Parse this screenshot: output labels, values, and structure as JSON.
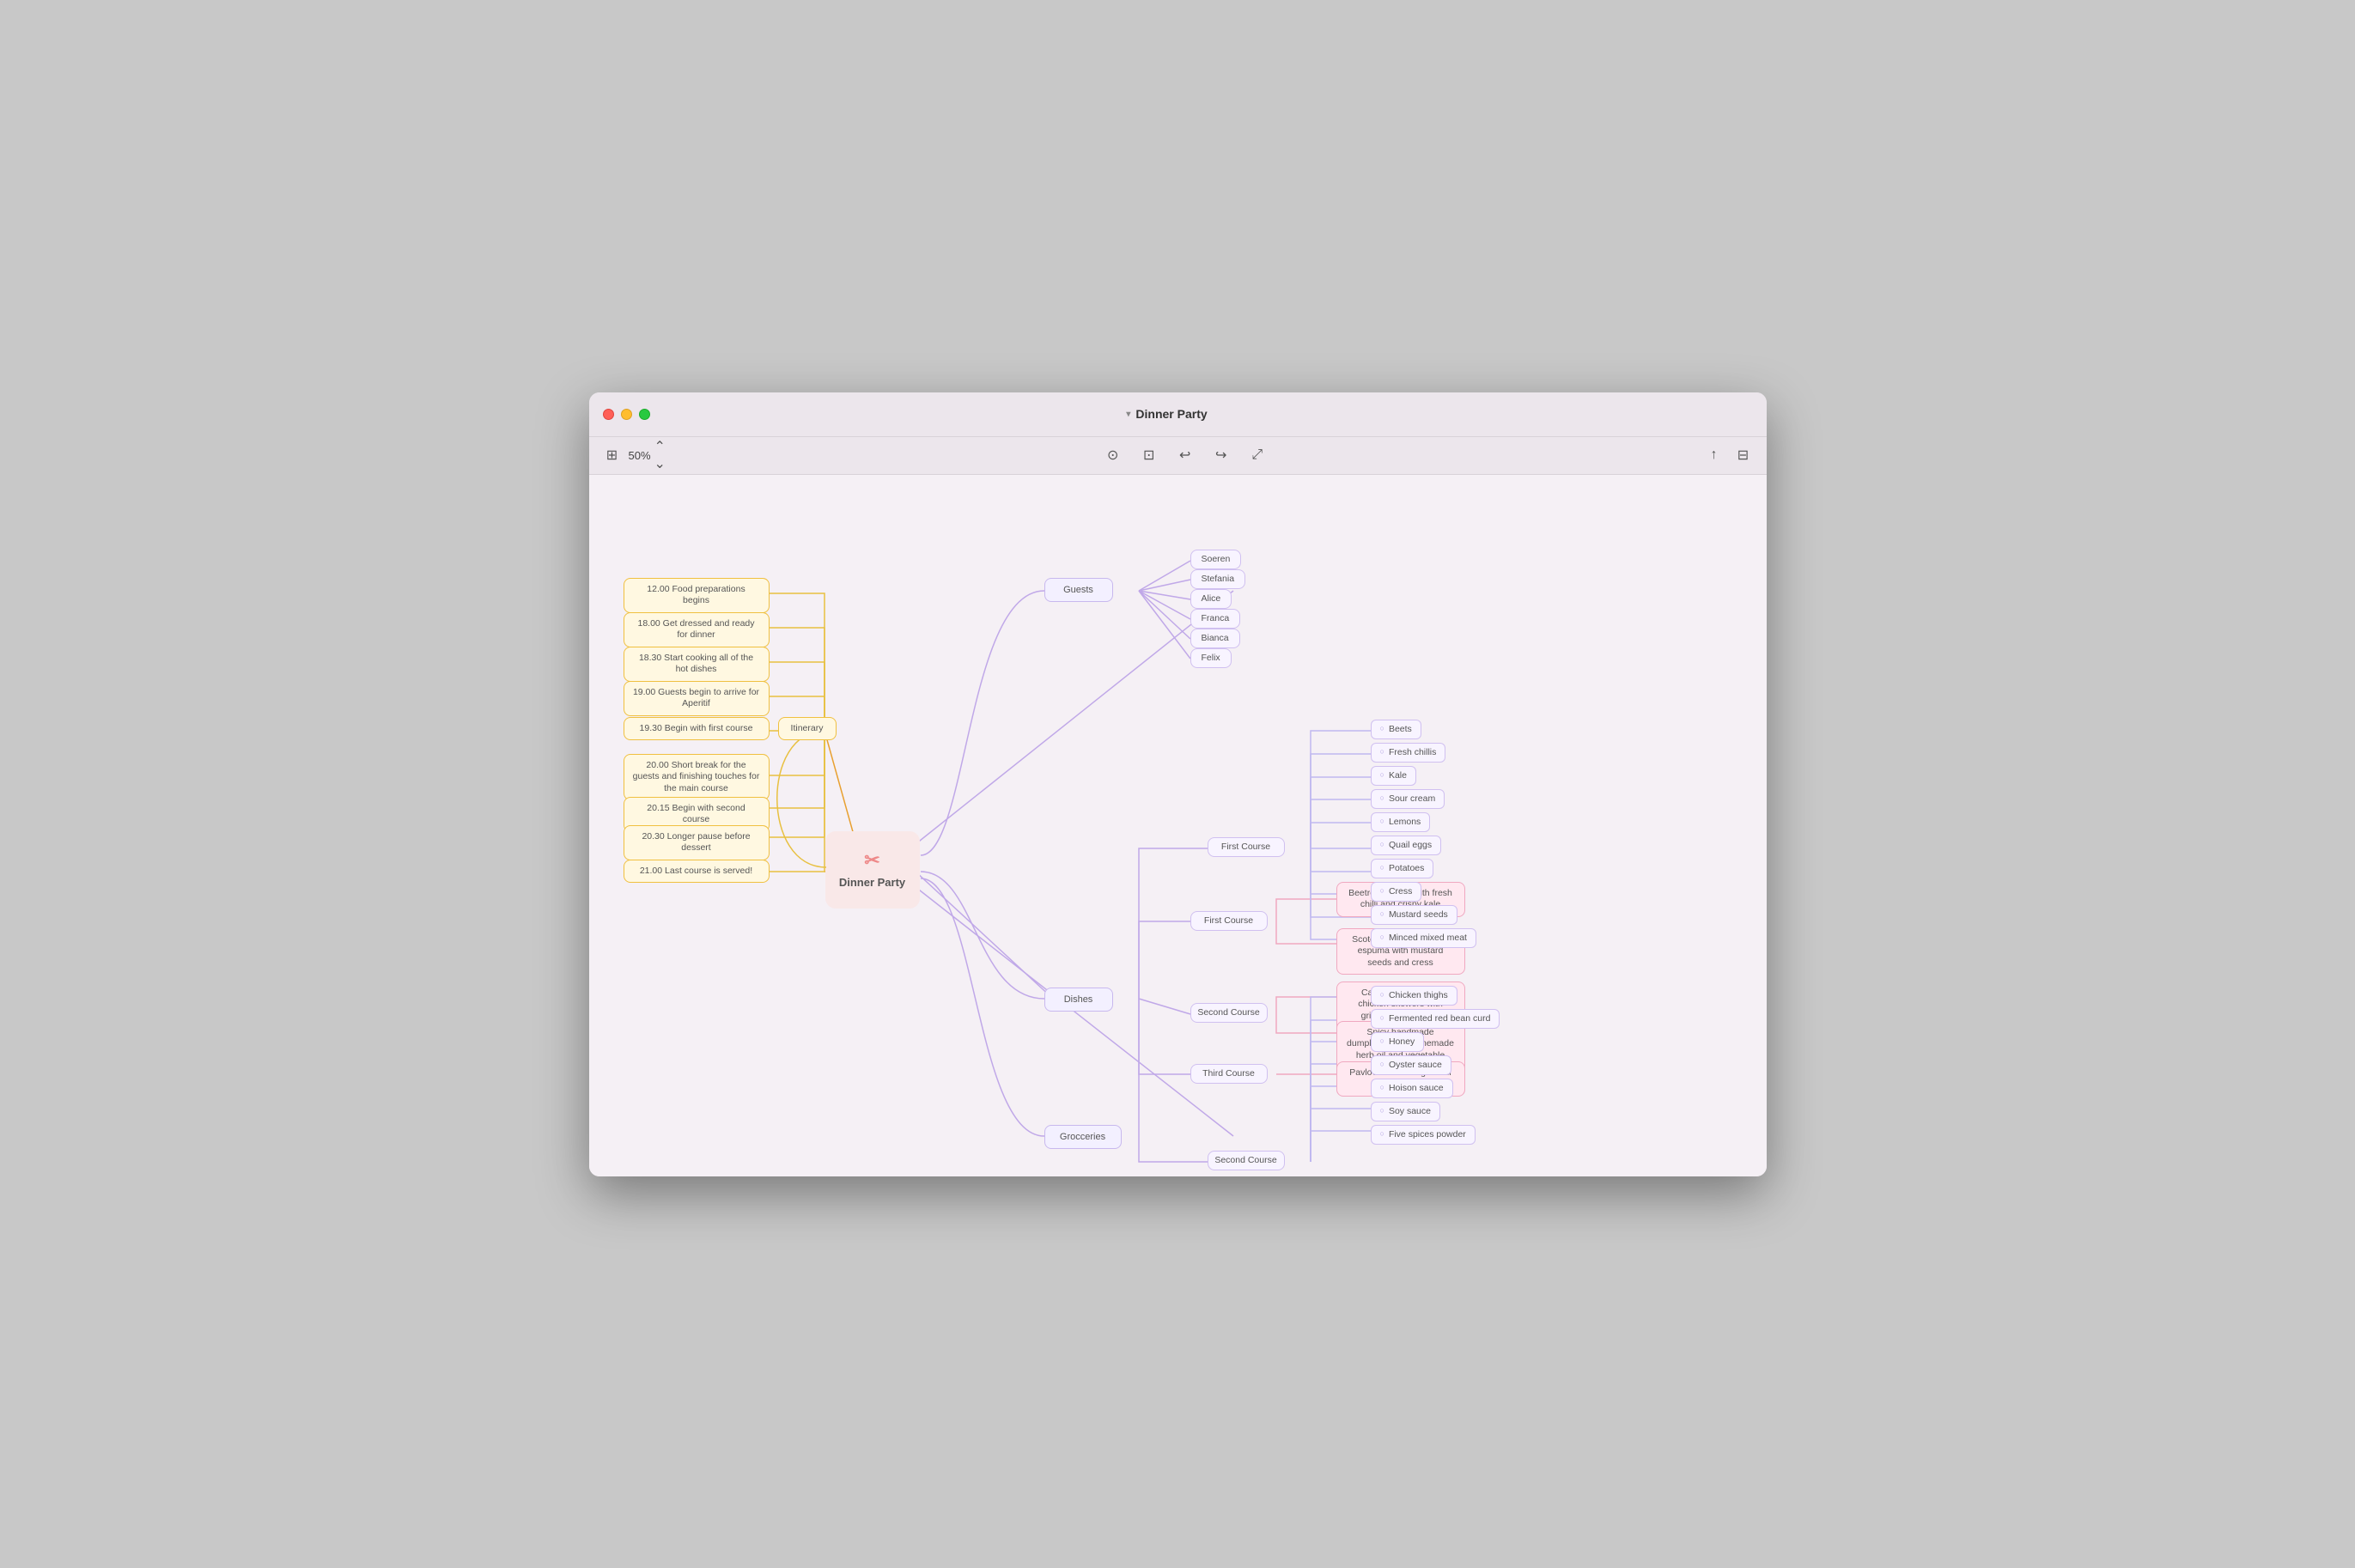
{
  "window": {
    "title": "Dinner Party"
  },
  "toolbar": {
    "zoom": "50%",
    "sidebar_icon": "⊞",
    "undo_icon": "↩",
    "redo_icon": "↪",
    "fit_icon": "⤢",
    "check_icon": "⊙",
    "image_icon": "⊡",
    "share_icon": "↑",
    "panel_icon": "⊟"
  },
  "center": {
    "label": "Dinner Party",
    "icon": "✂"
  },
  "itinerary": {
    "label": "Itinerary",
    "items": [
      "12.00 Food preparations begins",
      "18.00 Get dressed and ready for dinner",
      "18.30 Start cooking all of the hot dishes",
      "19.00 Guests begin to arrive for Aperitif",
      "19.30 Begin with first course",
      "20.00 Short break for the guests and finishing touches for the main course",
      "20.15 Begin with second course",
      "20.30 Longer pause before dessert",
      "21.00 Last course is served!"
    ]
  },
  "guests": {
    "label": "Guests",
    "items": [
      "Soeren",
      "Stefania",
      "Alice",
      "Franca",
      "Bianca",
      "Felix"
    ]
  },
  "dishes": {
    "label": "Dishes",
    "first_course": {
      "label": "First Course",
      "items": [
        "Beetroot tartare with fresh chilli and crispy kale",
        "Scotch quail egg, potato espuma with mustard seeds and cress"
      ]
    },
    "second_course": {
      "label": "Second Course",
      "items": [
        "Cantonese char-siu chicken skewers with grilled cabbage and blackberry sauce",
        "Spicy handmade dumplings with homemade herb oil and vegetable consommé"
      ]
    },
    "third_course": {
      "label": "Third Course",
      "items": [
        "Pavlova with orange-chilli ragout"
      ]
    }
  },
  "groceries": {
    "label": "Grocceries",
    "first_course": {
      "label": "First Course",
      "items": [
        "Beets",
        "Fresh chillis",
        "Kale",
        "Sour cream",
        "Lemons",
        "Quail eggs",
        "Potatoes",
        "Cress",
        "Mustard seeds",
        "Minced mixed meat"
      ]
    },
    "second_course": {
      "label": "Second Course",
      "items": [
        "Chicken thighs",
        "Fermented red bean curd",
        "Honey",
        "Oyster sauce",
        "Hoison sauce",
        "Soy sauce",
        "Five spices powder"
      ]
    }
  }
}
